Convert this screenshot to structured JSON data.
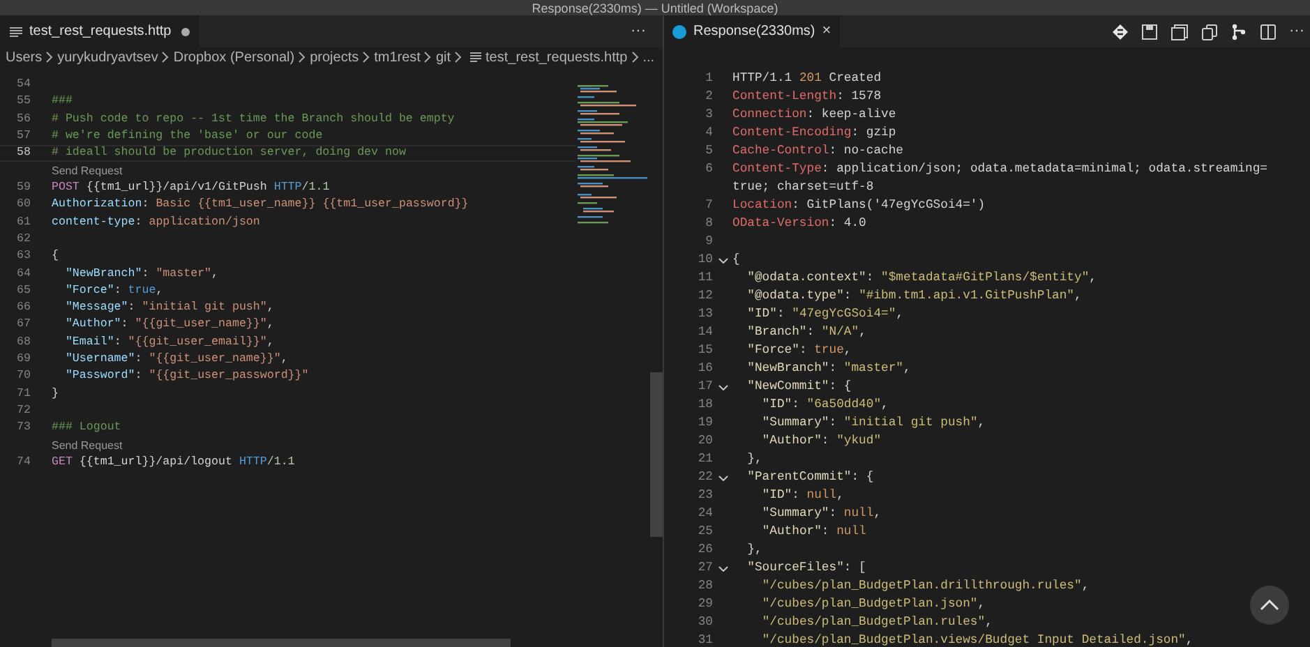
{
  "window": {
    "title": "Response(2330ms) — Untitled (Workspace)"
  },
  "editor": {
    "tab": {
      "label": "test_rest_requests.http",
      "modified": true,
      "selected": true
    },
    "more": "···",
    "breadcrumbs": [
      "Users",
      "yurykudryavtsev",
      "Dropbox (Personal)",
      "projects",
      "tm1rest",
      "git",
      "test_rest_requests.http",
      "..."
    ],
    "lines": [
      {
        "kind": "code",
        "number": "54",
        "current": false
      },
      {
        "kind": "code",
        "number": "55",
        "current": false,
        "tokens": [
          {
            "kind": "comment",
            "t": "###"
          }
        ]
      },
      {
        "kind": "code",
        "number": "56",
        "current": false,
        "tokens": [
          {
            "kind": "comment",
            "t": "# Push code to repo -- 1st time the Branch should be empty"
          }
        ]
      },
      {
        "kind": "code",
        "number": "57",
        "current": false,
        "tokens": [
          {
            "kind": "comment",
            "t": "# we're defining the 'base' or our code"
          }
        ]
      },
      {
        "kind": "code",
        "number": "58",
        "current": true,
        "tokens": [
          {
            "kind": "comment",
            "t": "# ideall should be production server, doing dev now"
          }
        ]
      },
      {
        "kind": "codelens",
        "text": "Send Request"
      },
      {
        "kind": "code",
        "number": "59",
        "current": false,
        "tokens": [
          {
            "kind": "method",
            "t": "POST"
          },
          {
            "kind": "plain",
            "t": " {{tm1_url}}/api/v1/GitPush "
          },
          {
            "kind": "proto",
            "t": "HTTP"
          },
          {
            "kind": "ver",
            "t": "/1.1"
          }
        ]
      },
      {
        "kind": "code",
        "number": "60",
        "current": false,
        "tokens": [
          {
            "kind": "header",
            "t": "Authorization"
          },
          {
            "kind": "plain",
            "t": ": "
          },
          {
            "kind": "value",
            "t": "Basic {{tm1_user_name}} {{tm1_user_password}}"
          }
        ]
      },
      {
        "kind": "code",
        "number": "61",
        "current": false,
        "tokens": [
          {
            "kind": "header",
            "t": "content-type"
          },
          {
            "kind": "plain",
            "t": ": "
          },
          {
            "kind": "value",
            "t": "application/json"
          }
        ]
      },
      {
        "kind": "code",
        "number": "62",
        "current": false
      },
      {
        "kind": "code",
        "number": "63",
        "current": false,
        "tokens": [
          {
            "kind": "plain",
            "t": "{"
          }
        ]
      },
      {
        "kind": "code",
        "number": "64",
        "current": false,
        "tokens": [
          {
            "kind": "key",
            "t": "  \"NewBranch\""
          },
          {
            "kind": "plain",
            "t": ": "
          },
          {
            "kind": "value",
            "t": "\"master\""
          },
          {
            "kind": "plain",
            "t": ","
          }
        ]
      },
      {
        "kind": "code",
        "number": "65",
        "current": false,
        "tokens": [
          {
            "kind": "key",
            "t": "  \"Force\""
          },
          {
            "kind": "plain",
            "t": ": "
          },
          {
            "kind": "lit",
            "t": "true"
          },
          {
            "kind": "plain",
            "t": ","
          }
        ]
      },
      {
        "kind": "code",
        "number": "66",
        "current": false,
        "tokens": [
          {
            "kind": "key",
            "t": "  \"Message\""
          },
          {
            "kind": "plain",
            "t": ": "
          },
          {
            "kind": "value",
            "t": "\"initial git push\""
          },
          {
            "kind": "plain",
            "t": ","
          }
        ]
      },
      {
        "kind": "code",
        "number": "67",
        "current": false,
        "tokens": [
          {
            "kind": "key",
            "t": "  \"Author\""
          },
          {
            "kind": "plain",
            "t": ": "
          },
          {
            "kind": "value",
            "t": "\"{{git_user_name}}\""
          },
          {
            "kind": "plain",
            "t": ","
          }
        ]
      },
      {
        "kind": "code",
        "number": "68",
        "current": false,
        "tokens": [
          {
            "kind": "key",
            "t": "  \"Email\""
          },
          {
            "kind": "plain",
            "t": ": "
          },
          {
            "kind": "value",
            "t": "\"{{git_user_email}}\""
          },
          {
            "kind": "plain",
            "t": ","
          }
        ]
      },
      {
        "kind": "code",
        "number": "69",
        "current": false,
        "tokens": [
          {
            "kind": "key",
            "t": "  \"Username\""
          },
          {
            "kind": "plain",
            "t": ": "
          },
          {
            "kind": "value",
            "t": "\"{{git_user_name}}\""
          },
          {
            "kind": "plain",
            "t": ","
          }
        ]
      },
      {
        "kind": "code",
        "number": "70",
        "current": false,
        "tokens": [
          {
            "kind": "key",
            "t": "  \"Password\""
          },
          {
            "kind": "plain",
            "t": ": "
          },
          {
            "kind": "value",
            "t": "\"{{git_user_password}}\""
          }
        ]
      },
      {
        "kind": "code",
        "number": "71",
        "current": false,
        "tokens": [
          {
            "kind": "plain",
            "t": "}"
          }
        ]
      },
      {
        "kind": "code",
        "number": "72",
        "current": false
      },
      {
        "kind": "code",
        "number": "73",
        "current": false,
        "tokens": [
          {
            "kind": "comment",
            "t": "### Logout"
          }
        ]
      },
      {
        "kind": "codelens",
        "text": "Send Request"
      },
      {
        "kind": "code",
        "number": "74",
        "current": false,
        "tokens": [
          {
            "kind": "method",
            "t": "GET"
          },
          {
            "kind": "plain",
            "t": " {{tm1_url}}/api/logout "
          },
          {
            "kind": "proto",
            "t": "HTTP"
          },
          {
            "kind": "ver",
            "t": "/1.1"
          }
        ]
      }
    ]
  },
  "response": {
    "tab": {
      "label": "Response(2330ms)",
      "selected": true
    },
    "close": "×",
    "more": "···",
    "lines": [
      {
        "number": "1",
        "foldable": false,
        "tokens": [
          {
            "kind": "plain",
            "t": "HTTP/1.1 "
          },
          {
            "kind": "status",
            "t": "201"
          },
          {
            "kind": "plain",
            "t": " Created"
          }
        ]
      },
      {
        "number": "2",
        "foldable": false,
        "tokens": [
          {
            "kind": "rheader",
            "t": "Content-Length"
          },
          {
            "kind": "plain",
            "t": ": 1578"
          }
        ]
      },
      {
        "number": "3",
        "foldable": false,
        "tokens": [
          {
            "kind": "rheader",
            "t": "Connection"
          },
          {
            "kind": "plain",
            "t": ": keep-alive"
          }
        ]
      },
      {
        "number": "4",
        "foldable": false,
        "tokens": [
          {
            "kind": "rheader",
            "t": "Content-Encoding"
          },
          {
            "kind": "plain",
            "t": ": gzip"
          }
        ]
      },
      {
        "number": "5",
        "foldable": false,
        "tokens": [
          {
            "kind": "rheader",
            "t": "Cache-Control"
          },
          {
            "kind": "plain",
            "t": ": no-cache"
          }
        ]
      },
      {
        "number": "6",
        "foldable": false,
        "tokens": [
          {
            "kind": "rheader",
            "t": "Content-Type"
          },
          {
            "kind": "plain",
            "t": ": application/json; odata.metadata=minimal; odata.streaming=true; charset=utf-8"
          }
        ]
      },
      {
        "number": "7",
        "foldable": false,
        "tokens": [
          {
            "kind": "rheader",
            "t": "Location"
          },
          {
            "kind": "plain",
            "t": ": GitPlans('47egYcGSoi4=')"
          }
        ]
      },
      {
        "number": "8",
        "foldable": false,
        "tokens": [
          {
            "kind": "rheader",
            "t": "OData-Version"
          },
          {
            "kind": "plain",
            "t": ": 4.0"
          }
        ]
      },
      {
        "number": "9",
        "foldable": false
      },
      {
        "number": "10",
        "foldable": true,
        "tokens": [
          {
            "kind": "plain",
            "t": "{"
          }
        ]
      },
      {
        "number": "11",
        "foldable": false,
        "tokens": [
          {
            "kind": "rkey",
            "t": "  \"@odata.context\""
          },
          {
            "kind": "plain",
            "t": ": "
          },
          {
            "kind": "rstr",
            "t": "\"$metadata#GitPlans/$entity\""
          },
          {
            "kind": "plain",
            "t": ","
          }
        ]
      },
      {
        "number": "12",
        "foldable": false,
        "tokens": [
          {
            "kind": "rkey",
            "t": "  \"@odata.type\""
          },
          {
            "kind": "plain",
            "t": ": "
          },
          {
            "kind": "rstr",
            "t": "\"#ibm.tm1.api.v1.GitPushPlan\""
          },
          {
            "kind": "plain",
            "t": ","
          }
        ]
      },
      {
        "number": "13",
        "foldable": false,
        "tokens": [
          {
            "kind": "rkey",
            "t": "  \"ID\""
          },
          {
            "kind": "plain",
            "t": ": "
          },
          {
            "kind": "rstr",
            "t": "\"47egYcGSoi4=\""
          },
          {
            "kind": "plain",
            "t": ","
          }
        ]
      },
      {
        "number": "14",
        "foldable": false,
        "tokens": [
          {
            "kind": "rkey",
            "t": "  \"Branch\""
          },
          {
            "kind": "plain",
            "t": ": "
          },
          {
            "kind": "rstr",
            "t": "\"N/A\""
          },
          {
            "kind": "plain",
            "t": ","
          }
        ]
      },
      {
        "number": "15",
        "foldable": false,
        "tokens": [
          {
            "kind": "rkey",
            "t": "  \"Force\""
          },
          {
            "kind": "plain",
            "t": ": "
          },
          {
            "kind": "rlit",
            "t": "true"
          },
          {
            "kind": "plain",
            "t": ","
          }
        ]
      },
      {
        "number": "16",
        "foldable": false,
        "tokens": [
          {
            "kind": "rkey",
            "t": "  \"NewBranch\""
          },
          {
            "kind": "plain",
            "t": ": "
          },
          {
            "kind": "rstr",
            "t": "\"master\""
          },
          {
            "kind": "plain",
            "t": ","
          }
        ]
      },
      {
        "number": "17",
        "foldable": true,
        "tokens": [
          {
            "kind": "rkey",
            "t": "  \"NewCommit\""
          },
          {
            "kind": "plain",
            "t": ": {"
          }
        ]
      },
      {
        "number": "18",
        "foldable": false,
        "tokens": [
          {
            "kind": "rkey",
            "t": "    \"ID\""
          },
          {
            "kind": "plain",
            "t": ": "
          },
          {
            "kind": "rstr",
            "t": "\"6a50dd40\""
          },
          {
            "kind": "plain",
            "t": ","
          }
        ]
      },
      {
        "number": "19",
        "foldable": false,
        "tokens": [
          {
            "kind": "rkey",
            "t": "    \"Summary\""
          },
          {
            "kind": "plain",
            "t": ": "
          },
          {
            "kind": "rstr",
            "t": "\"initial git push\""
          },
          {
            "kind": "plain",
            "t": ","
          }
        ]
      },
      {
        "number": "20",
        "foldable": false,
        "tokens": [
          {
            "kind": "rkey",
            "t": "    \"Author\""
          },
          {
            "kind": "plain",
            "t": ": "
          },
          {
            "kind": "rstr",
            "t": "\"ykud\""
          }
        ]
      },
      {
        "number": "21",
        "foldable": false,
        "tokens": [
          {
            "kind": "plain",
            "t": "  },"
          }
        ]
      },
      {
        "number": "22",
        "foldable": true,
        "tokens": [
          {
            "kind": "rkey",
            "t": "  \"ParentCommit\""
          },
          {
            "kind": "plain",
            "t": ": {"
          }
        ]
      },
      {
        "number": "23",
        "foldable": false,
        "tokens": [
          {
            "kind": "rkey",
            "t": "    \"ID\""
          },
          {
            "kind": "plain",
            "t": ": "
          },
          {
            "kind": "rlit",
            "t": "null"
          },
          {
            "kind": "plain",
            "t": ","
          }
        ]
      },
      {
        "number": "24",
        "foldable": false,
        "tokens": [
          {
            "kind": "rkey",
            "t": "    \"Summary\""
          },
          {
            "kind": "plain",
            "t": ": "
          },
          {
            "kind": "rlit",
            "t": "null"
          },
          {
            "kind": "plain",
            "t": ","
          }
        ]
      },
      {
        "number": "25",
        "foldable": false,
        "tokens": [
          {
            "kind": "rkey",
            "t": "    \"Author\""
          },
          {
            "kind": "plain",
            "t": ": "
          },
          {
            "kind": "rlit",
            "t": "null"
          }
        ]
      },
      {
        "number": "26",
        "foldable": false,
        "tokens": [
          {
            "kind": "plain",
            "t": "  },"
          }
        ]
      },
      {
        "number": "27",
        "foldable": true,
        "tokens": [
          {
            "kind": "rkey",
            "t": "  \"SourceFiles\""
          },
          {
            "kind": "plain",
            "t": ": ["
          }
        ]
      },
      {
        "number": "28",
        "foldable": false,
        "tokens": [
          {
            "kind": "rstr",
            "t": "    \"/cubes/plan_BudgetPlan.drillthrough.rules\""
          },
          {
            "kind": "plain",
            "t": ","
          }
        ]
      },
      {
        "number": "29",
        "foldable": false,
        "tokens": [
          {
            "kind": "rstr",
            "t": "    \"/cubes/plan_BudgetPlan.json\""
          },
          {
            "kind": "plain",
            "t": ","
          }
        ]
      },
      {
        "number": "30",
        "foldable": false,
        "tokens": [
          {
            "kind": "rstr",
            "t": "    \"/cubes/plan_BudgetPlan.rules\""
          },
          {
            "kind": "plain",
            "t": ","
          }
        ]
      },
      {
        "number": "31",
        "foldable": false,
        "tokens": [
          {
            "kind": "rstr",
            "t": "    \"/cubes/plan_BudgetPlan.views/Budget Input Detailed.json\""
          },
          {
            "kind": "plain",
            "t": ","
          }
        ]
      }
    ]
  }
}
